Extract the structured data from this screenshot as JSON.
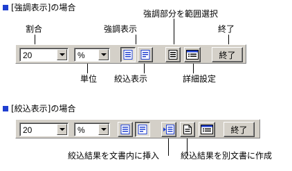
{
  "section1": {
    "heading": "[強調表示]の場合",
    "zoom_value": "20",
    "unit_value": "%",
    "end_label": "終了",
    "annotations": {
      "zoom": "割合",
      "highlight": "強調表示",
      "select_highlight": "強調部分を範囲選択",
      "end": "終了",
      "unit": "単位",
      "filter": "絞込表示",
      "detail": "詳細設定"
    }
  },
  "section2": {
    "heading": "[絞込表示]の場合",
    "zoom_value": "20",
    "unit_value": "%",
    "end_label": "終了",
    "annotations": {
      "insert_result": "絞込結果を文書内に挿入",
      "create_result": "絞込結果を別文書に作成"
    }
  },
  "colors": {
    "bullet": "#1f3fd0",
    "toolbar": "#d4d0c8",
    "icon_blue": "#1f3fd0"
  },
  "icons": [
    "highlight-view-icon",
    "filter-view-icon",
    "select-range-icon",
    "detail-settings-icon",
    "insert-result-icon",
    "create-document-icon",
    "dropdown-arrow-icon"
  ]
}
